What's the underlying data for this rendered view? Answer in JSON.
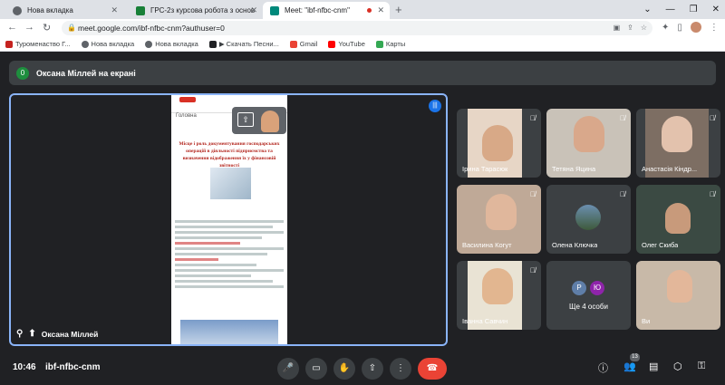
{
  "browser": {
    "tabs": [
      {
        "label": "Нова вкладка",
        "fav_color": "#5f6368"
      },
      {
        "label": "ГРС-2з курсова робота з основ",
        "fav_color": "#188038"
      },
      {
        "label": "Meet: \"ibf-nfbc-cnm\"",
        "fav_color": "#00897b"
      }
    ],
    "new_tab": "+",
    "url": "meet.google.com/ibf-nfbc-cnm?authuser=0",
    "bookmarks": [
      {
        "label": "Туроменаство Г...",
        "color": "#c5221f"
      },
      {
        "label": "Нова вкладка",
        "color": "#5f6368"
      },
      {
        "label": "Нова вкладка",
        "color": "#5f6368"
      },
      {
        "label": "▶ Скачать Песни...",
        "color": "#202124"
      },
      {
        "label": "Gmail",
        "color": "#ea4335"
      },
      {
        "label": "YouTube",
        "color": "#ff0000"
      },
      {
        "label": "Карты",
        "color": "#34a853"
      }
    ]
  },
  "meet": {
    "presenting": {
      "badge": "0",
      "text": "Оксана Міллей на екрані"
    },
    "stage": {
      "presenter_name": "Оксана Міллей",
      "doc_mini": "Головна",
      "doc_title": "Місце і роль документування господарських операцій в діяльності підприємства та визначення відображення їх у фінансовій звітності"
    },
    "participants": [
      {
        "name": "Ірина Тарасюк",
        "type": "video",
        "bg": "#e7d6c6"
      },
      {
        "name": "Тетяна Яцина",
        "type": "video",
        "bg": "#c9c2b8"
      },
      {
        "name": "Анастасія Кіндр...",
        "type": "video",
        "bg": "#7d6e63"
      },
      {
        "name": "Василина Когут",
        "type": "video",
        "bg": "#bfa997"
      },
      {
        "name": "Олена Ключка",
        "type": "avatar",
        "bg": "#3c4043"
      },
      {
        "name": "Олег Скиба",
        "type": "video",
        "bg": "#3b4a43"
      },
      {
        "name": "Іванна Савчин",
        "type": "video",
        "bg": "#e9e3d4"
      },
      {
        "name": "Ще 4 особи",
        "type": "more",
        "bg": "#3c4043",
        "chips": [
          "Р",
          "Ю"
        ]
      },
      {
        "name": "Ви",
        "type": "video",
        "bg": "#c8b9a8"
      }
    ],
    "bottom": {
      "time": "10:46",
      "code": "ibf-nfbc-cnm",
      "people_count": "13"
    }
  }
}
